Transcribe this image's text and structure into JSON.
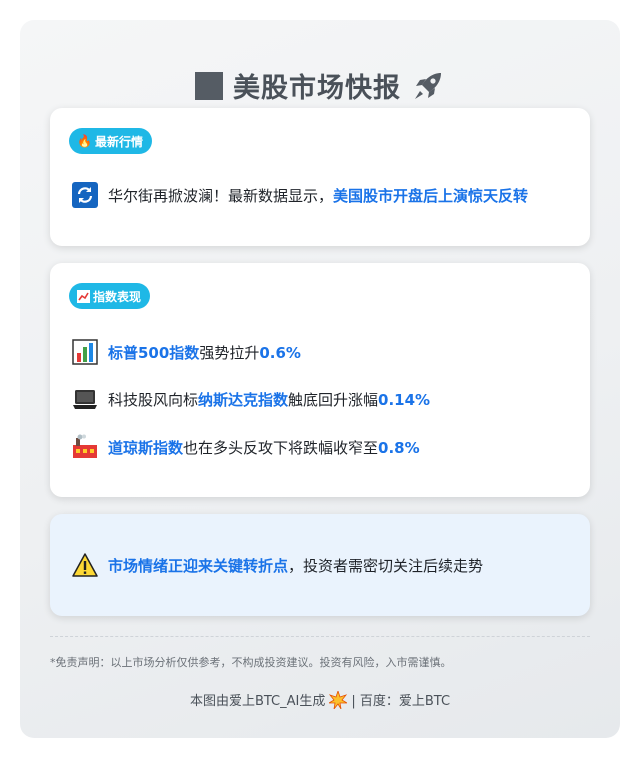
{
  "header": {
    "title": "美股市场快报",
    "square_icon": "black-square-icon",
    "rocket_icon": "rocket-icon"
  },
  "latest": {
    "tag_icon": "fire-icon",
    "tag": "最新行情",
    "icon": "refresh-icon",
    "text_plain": "华尔街再掀波澜！最新数据显示，",
    "text_highlight": "美国股市开盘后上演惊天反转"
  },
  "indices": {
    "tag_icon": "chart-up-icon",
    "tag": "指数表现",
    "items": [
      {
        "icon": "bar-chart-icon",
        "pre": "",
        "name": "标普500指数",
        "mid": "强势拉升",
        "value": "0.6%"
      },
      {
        "icon": "laptop-icon",
        "pre": "科技股风向标",
        "name": "纳斯达克指数",
        "mid": "触底回升涨幅",
        "value": "0.14%"
      },
      {
        "icon": "factory-icon",
        "pre": "",
        "name": "道琼斯指数",
        "mid": "也在多头反攻下将跌幅收窄至",
        "value": "0.8%"
      }
    ]
  },
  "sentiment": {
    "icon": "warning-icon",
    "highlight": "市场情绪正迎来关键转折点",
    "text": "，投资者需密切关注后续走势"
  },
  "disclaimer": "*免责声明：以上市场分析仅供参考，不构成投资建议。投资有风险，入市需谨慎。",
  "footer": {
    "left": "本图由爱上BTC_AI生成",
    "icon": "burst-icon",
    "right": "| 百度：爱上BTC"
  },
  "colors": {
    "accent": "#1a73e8",
    "pill": "#1fb8e6",
    "title": "#4a5159"
  }
}
